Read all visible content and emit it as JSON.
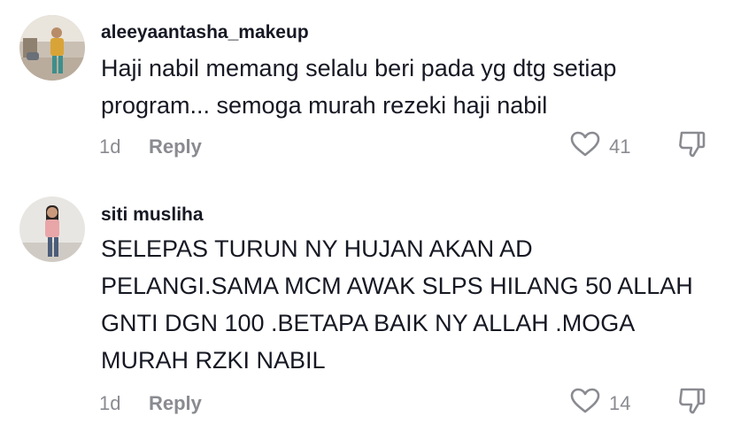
{
  "comments": [
    {
      "username": "aleeyaantasha_makeup",
      "text": "Haji nabil memang selalu beri pada yg dtg setiap program... semoga murah rezeki haji nabil",
      "time": "1d",
      "reply_label": "Reply",
      "likes": "41"
    },
    {
      "username": "siti musliha",
      "text": "SELEPAS TURUN NY HUJAN AKAN AD PELANGI.SAMA MCM AWAK SLPS HILANG 50 ALLAH GNTI DGN 100 .BETAPA BAIK NY ALLAH .MOGA MURAH RZKI NABIL",
      "time": "1d",
      "reply_label": "Reply",
      "likes": "14"
    }
  ],
  "icons": {
    "like": "heart-outline-icon",
    "dislike": "thumbs-down-icon"
  },
  "colors": {
    "text": "#161823",
    "secondary": "#8a8b91"
  }
}
